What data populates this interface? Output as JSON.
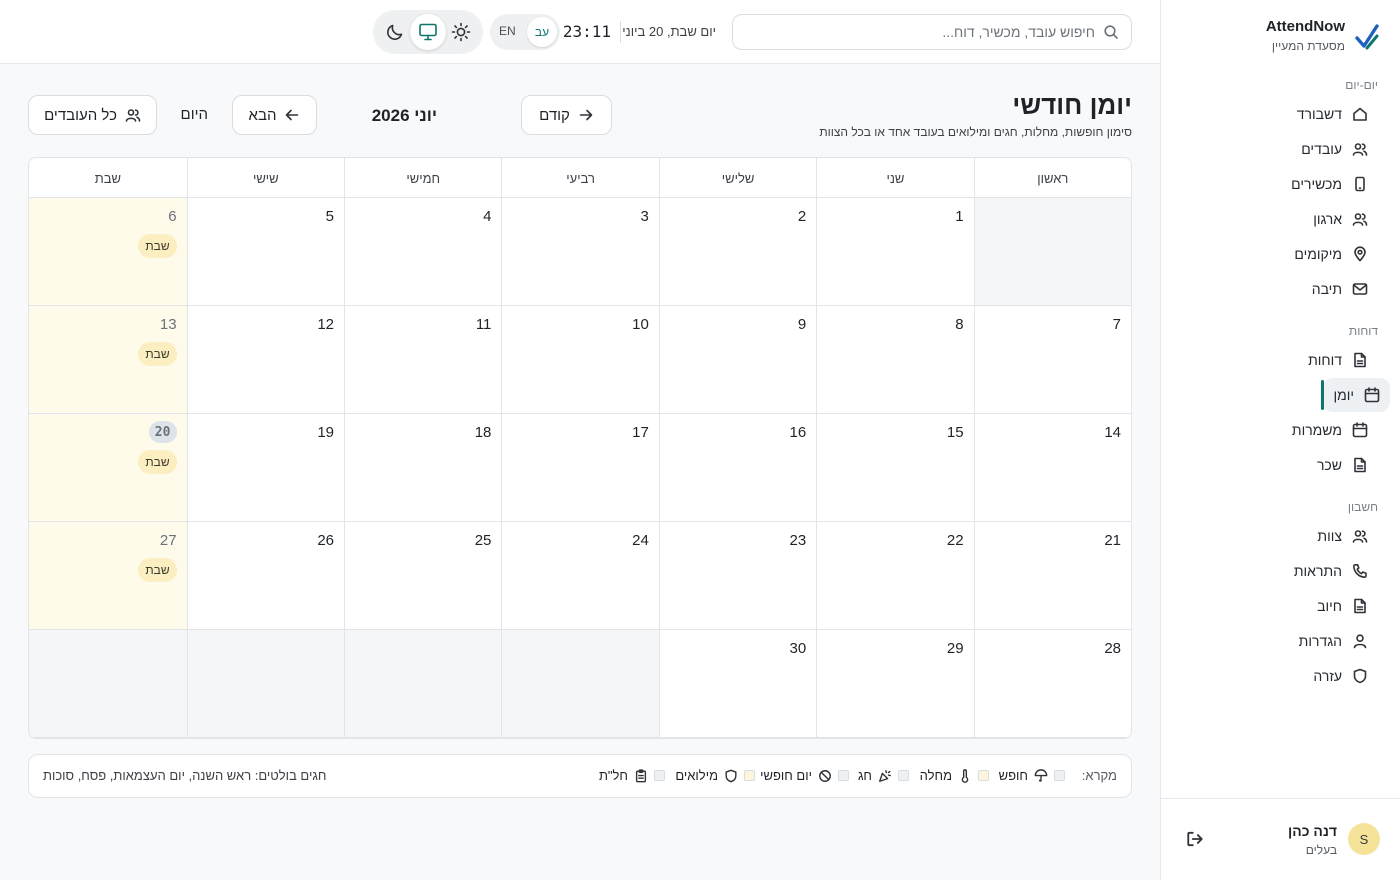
{
  "brand": {
    "name": "AttendNow",
    "subtitle": "מסעדת המעיין"
  },
  "sidebar": {
    "sections": [
      {
        "title": "יום-יום",
        "items": [
          {
            "label": "דשבורד",
            "icon": "home-icon"
          },
          {
            "label": "עובדים",
            "icon": "users-icon"
          },
          {
            "label": "מכשירים",
            "icon": "device-icon"
          },
          {
            "label": "ארגון",
            "icon": "users-icon"
          },
          {
            "label": "מיקומים",
            "icon": "map-pin-icon"
          },
          {
            "label": "תיבה",
            "icon": "mail-icon"
          }
        ]
      },
      {
        "title": "דוחות",
        "items": [
          {
            "label": "דוחות",
            "icon": "file-icon"
          },
          {
            "label": "יומן",
            "icon": "calendar-icon",
            "active": true
          },
          {
            "label": "משמרות",
            "icon": "calendar-icon"
          },
          {
            "label": "שכר",
            "icon": "file-icon"
          }
        ]
      },
      {
        "title": "חשבון",
        "items": [
          {
            "label": "צוות",
            "icon": "users-icon"
          },
          {
            "label": "התראות",
            "icon": "phone-icon"
          },
          {
            "label": "חיוב",
            "icon": "file-icon"
          },
          {
            "label": "הגדרות",
            "icon": "user-icon"
          },
          {
            "label": "עזרה",
            "icon": "shield-icon"
          }
        ]
      }
    ],
    "user": {
      "initial": "S",
      "name": "דנה כהן",
      "role": "בעלים"
    }
  },
  "topbar": {
    "search_placeholder": "חיפוש עובד, מכשיר, דוח...",
    "date": "יום שבת, 20 ביוני",
    "time": "23:11",
    "lang_active": "עב",
    "lang_other": "EN",
    "theme_selected": "system"
  },
  "page": {
    "title": "יומן חודשי",
    "subtitle": "סימון חופשות, מחלות, חגים ומילואים בעובד אחד או בכל הצוות",
    "prev_label": "קודם",
    "next_label": "הבא",
    "month_label": "יוני 2026",
    "today_label": "היום",
    "all_employees_label": "כל העובדים"
  },
  "calendar": {
    "weekdays": [
      "ראשון",
      "שני",
      "שלישי",
      "רביעי",
      "חמישי",
      "שישי",
      "שבת"
    ],
    "first_weekday_index": 1,
    "days_in_month": 30,
    "today": 20,
    "saturday_badge": "שבת"
  },
  "legend": {
    "title": "מקרא:",
    "items": [
      {
        "label": "חופש",
        "icon": "umbrella-icon",
        "color": "#eef1f4"
      },
      {
        "label": "מחלה",
        "icon": "thermometer-icon",
        "color": "#fdf6dd"
      },
      {
        "label": "חג",
        "icon": "party-icon",
        "color": "#eef1f4"
      },
      {
        "label": "יום חופשי",
        "icon": "ban-icon",
        "color": "#eef1f4"
      },
      {
        "label": "מילואים",
        "icon": "shield-icon",
        "color": "#fdf6dd"
      },
      {
        "label": "חל\"ת",
        "icon": "clipboard-icon",
        "color": "#eef1f4"
      }
    ],
    "note": "חגים בולטים: ראש השנה, יום העצמאות, פסח, סוכות"
  },
  "colors": {
    "accent": "#0f766e",
    "saturday_bg": "#fffbea",
    "saturday_badge": "#fbeec0",
    "empty_cell": "#f5f6f7"
  }
}
